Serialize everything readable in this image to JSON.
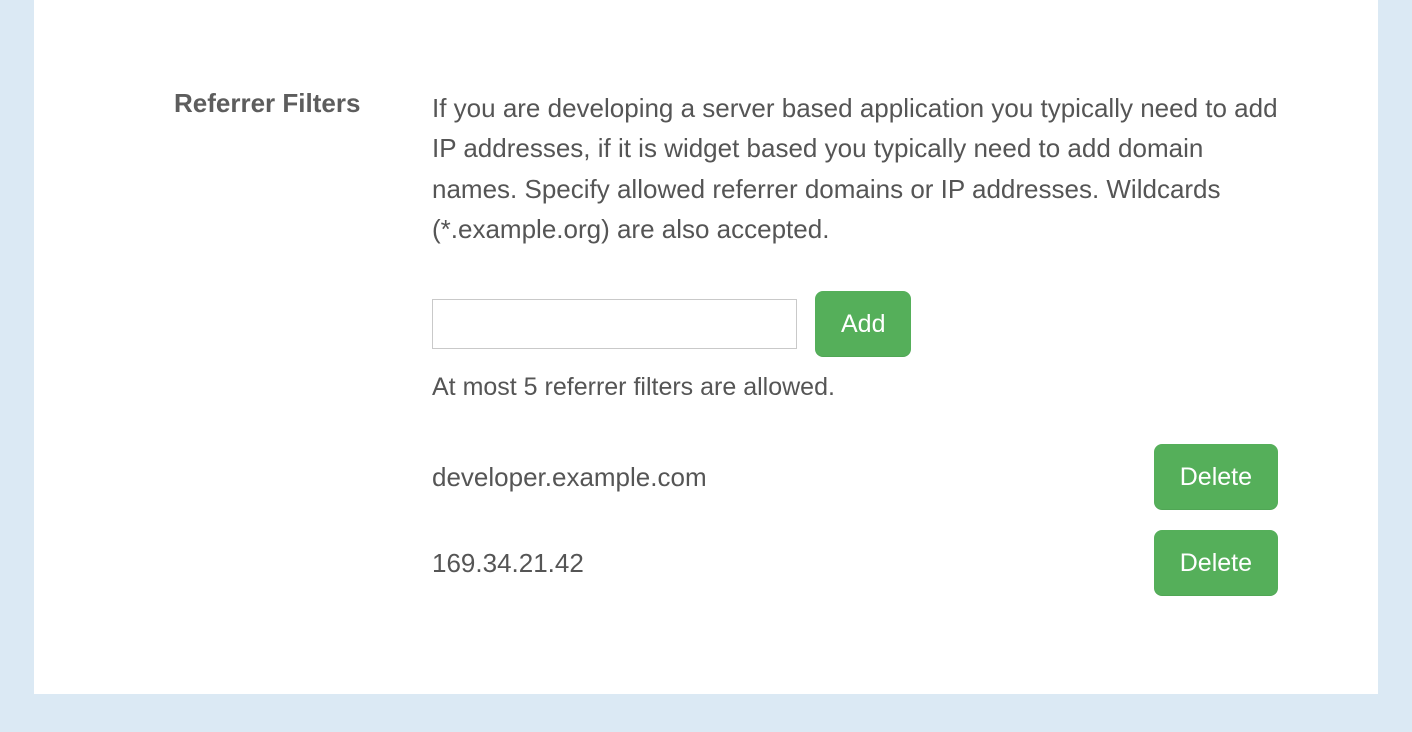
{
  "section": {
    "title": "Referrer Filters",
    "description": "If you are developing a server based application you typically need to add IP addresses, if it is widget based you typically need to add domain names. Specify allowed referrer domains or IP addresses. Wildcards (*.example.org) are also accepted.",
    "hint": "At most 5 referrer filters are allowed."
  },
  "input": {
    "value": "",
    "placeholder": ""
  },
  "buttons": {
    "add": "Add",
    "delete": "Delete"
  },
  "filters": [
    {
      "value": "developer.example.com"
    },
    {
      "value": "169.34.21.42"
    }
  ]
}
